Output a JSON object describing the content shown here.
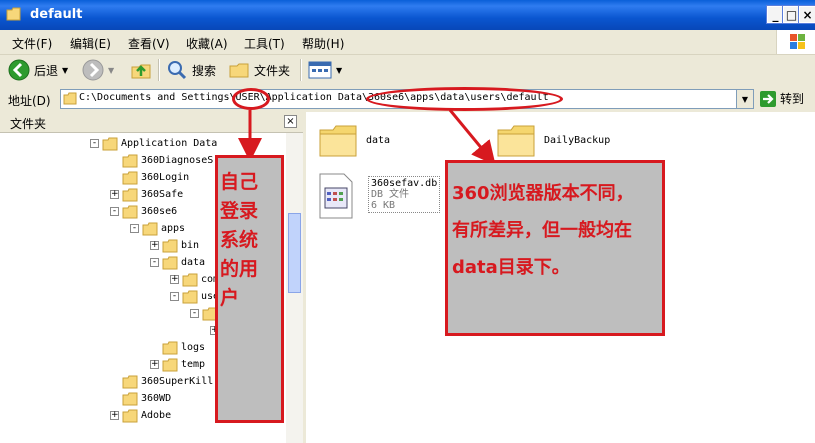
{
  "window": {
    "title": "default"
  },
  "menu": [
    "文件(F)",
    "编辑(E)",
    "查看(V)",
    "收藏(A)",
    "工具(T)",
    "帮助(H)"
  ],
  "toolbar": {
    "back": "后退",
    "search": "搜索",
    "folders": "文件夹"
  },
  "address": {
    "label": "地址(D)",
    "path": "C:\\Documents and Settings\\USER\\Application Data\\360se6\\apps\\data\\users\\default",
    "go": "转到"
  },
  "folder_pane": {
    "title": "文件夹",
    "tree": [
      {
        "label": "Application Data",
        "expander": "-"
      },
      {
        "label": "360DiagnoseS",
        "expander": ""
      },
      {
        "label": "360Login",
        "expander": ""
      },
      {
        "label": "360Safe",
        "expander": "+"
      },
      {
        "label": "360se6",
        "expander": "-"
      },
      {
        "label": "apps",
        "expander": "-"
      },
      {
        "label": "bin",
        "expander": "+"
      },
      {
        "label": "data",
        "expander": "-"
      },
      {
        "label": "com",
        "expander": "+"
      },
      {
        "label": "use",
        "expander": "-"
      },
      {
        "label": "",
        "expander": "-"
      },
      {
        "label": "",
        "expander": "+"
      },
      {
        "label": "logs",
        "expander": ""
      },
      {
        "label": "temp",
        "expander": "+"
      },
      {
        "label": "360SuperKill",
        "expander": ""
      },
      {
        "label": "360WD",
        "expander": ""
      },
      {
        "label": "Adobe",
        "expander": "+"
      }
    ]
  },
  "content": {
    "items": [
      {
        "name": "data"
      },
      {
        "name": "DailyBackup"
      },
      {
        "name": "360sefav.db",
        "type": "DB 文件",
        "size": "6 KB"
      }
    ]
  },
  "annotations": {
    "user_note": [
      "自己",
      "登录",
      "系统",
      "的用",
      "户"
    ],
    "version_note": [
      "360浏览器版本不同，",
      "有所差异，但一般均在",
      "data目录下。"
    ]
  }
}
